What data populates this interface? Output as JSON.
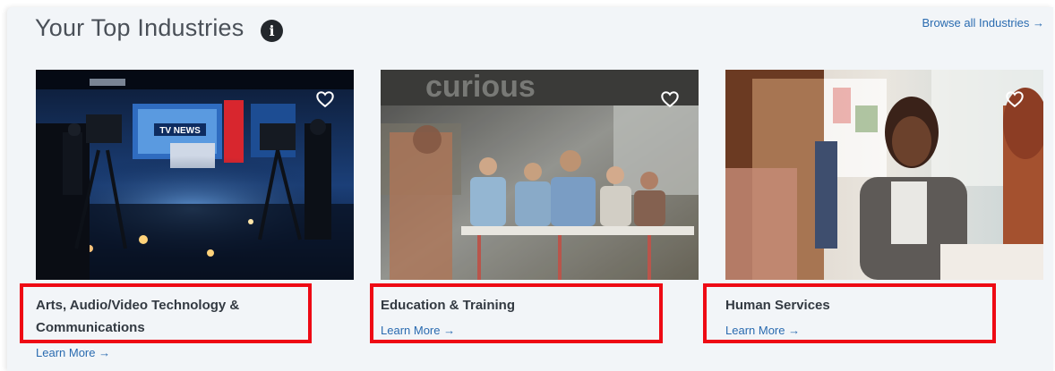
{
  "section": {
    "title": "Your Top Industries",
    "info_icon": "info-icon",
    "info_glyph": "i",
    "browse_link": "Browse all Industries →"
  },
  "cards": [
    {
      "name_line1": "Arts, Audio/Video Technology &",
      "name_line2": "Communications",
      "learn_more": "Learn More →",
      "icon": "heart-icon"
    },
    {
      "name_line1": "Education & Training",
      "learn_more": "Learn More →",
      "icon": "heart-icon"
    },
    {
      "name_line1": "Human Services",
      "learn_more": "Learn More →",
      "icon": "heart-icon"
    }
  ],
  "photos": {
    "studio_sign": "TV NEWS"
  },
  "colors": {
    "panel_bg": "#f2f5f8",
    "link": "#2a6bb0",
    "highlight": "#ee0a14"
  }
}
